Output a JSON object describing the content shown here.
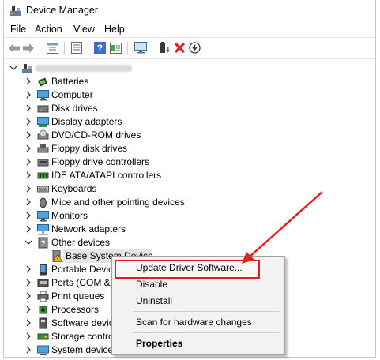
{
  "window": {
    "title": "Device Manager"
  },
  "menubar": [
    "File",
    "Action",
    "View",
    "Help"
  ],
  "toolbar_icons": [
    "back-icon",
    "forward-icon",
    "properties-grid-icon",
    "list-icon",
    "help-icon",
    "details-icon",
    "monitor-icon",
    "update-driver-icon",
    "uninstall-x-icon",
    "scan-download-icon"
  ],
  "tree": {
    "root_label": "",
    "items": [
      {
        "label": "Batteries",
        "icon": "battery-icon"
      },
      {
        "label": "Computer",
        "icon": "computer-icon"
      },
      {
        "label": "Disk drives",
        "icon": "disk-drive-icon"
      },
      {
        "label": "Display adapters",
        "icon": "display-adapter-icon"
      },
      {
        "label": "DVD/CD-ROM drives",
        "icon": "dvd-icon"
      },
      {
        "label": "Floppy disk drives",
        "icon": "floppy-icon"
      },
      {
        "label": "Floppy drive controllers",
        "icon": "floppy-controller-icon"
      },
      {
        "label": "IDE ATA/ATAPI controllers",
        "icon": "ide-icon"
      },
      {
        "label": "Keyboards",
        "icon": "keyboard-icon"
      },
      {
        "label": "Mice and other pointing devices",
        "icon": "mouse-icon"
      },
      {
        "label": "Monitors",
        "icon": "monitor-icon"
      },
      {
        "label": "Network adapters",
        "icon": "network-icon"
      },
      {
        "label": "Other devices",
        "icon": "other-devices-icon",
        "expanded": true
      },
      {
        "label": "Base System Device",
        "icon": "warning-device-icon",
        "child": true
      },
      {
        "label": "Portable Devices",
        "icon": "portable-icon"
      },
      {
        "label": "Ports (COM & LPT)",
        "icon": "ports-icon"
      },
      {
        "label": "Print queues",
        "icon": "printer-icon"
      },
      {
        "label": "Processors",
        "icon": "processor-icon"
      },
      {
        "label": "Software devices",
        "icon": "software-icon"
      },
      {
        "label": "Storage controllers",
        "icon": "storage-icon"
      },
      {
        "label": "System devices",
        "icon": "system-icon"
      }
    ]
  },
  "context_menu": {
    "items": [
      "Update Driver Software...",
      "Disable",
      "Uninstall",
      "Scan for hardware changes",
      "Properties"
    ],
    "highlighted": "Update Driver Software..."
  },
  "colors": {
    "annotation_red": "#e02020",
    "menu_bg": "#f2f2f2",
    "highlight_border": "#e02020"
  }
}
